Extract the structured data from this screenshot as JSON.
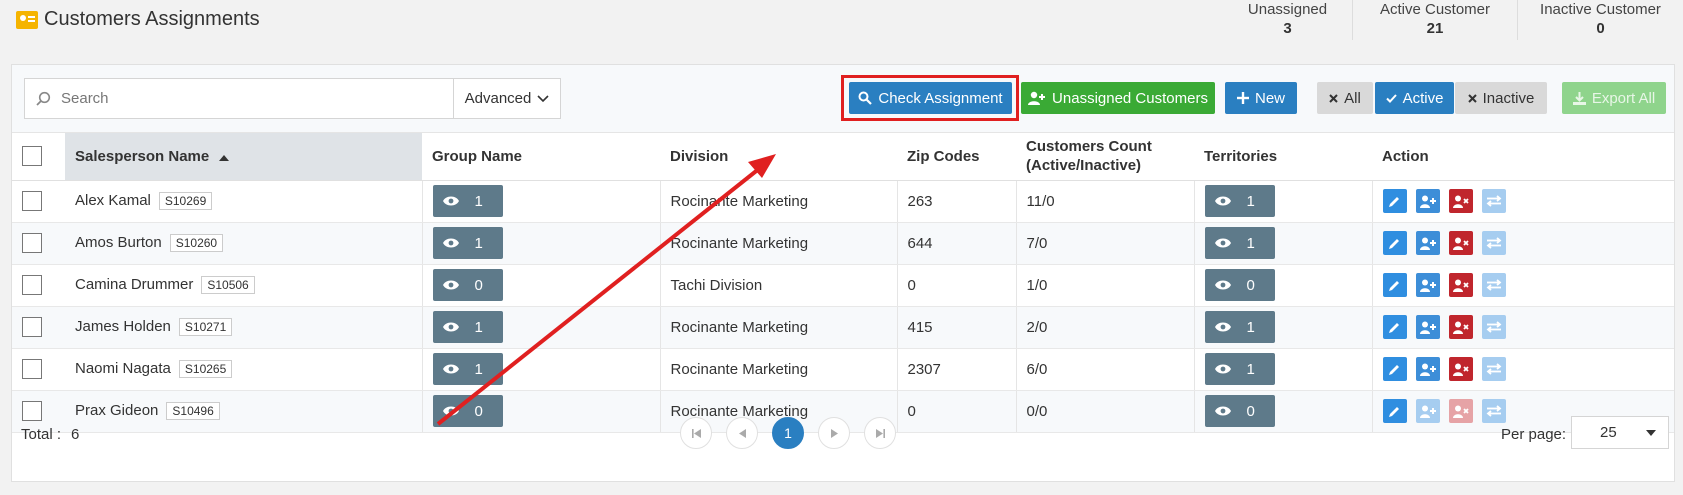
{
  "header": {
    "title": "Customers Assignments",
    "stats": [
      {
        "label": "Unassigned",
        "value": "3"
      },
      {
        "label": "Active Customer",
        "value": "21"
      },
      {
        "label": "Inactive Customer",
        "value": "0"
      }
    ]
  },
  "toolbar": {
    "search_placeholder": "Search",
    "advanced_label": "Advanced",
    "check_assignment_label": "Check Assignment",
    "unassigned_customers_label": "Unassigned Customers",
    "new_label": "New",
    "filter_all_label": "All",
    "filter_active_label": "Active",
    "filter_inactive_label": "Inactive",
    "export_label": "Export All"
  },
  "table": {
    "columns": {
      "salesperson": "Salesperson Name",
      "group": "Group Name",
      "division": "Division",
      "zip": "Zip Codes",
      "count_line1": "Customers Count",
      "count_line2": "(Active/Inactive)",
      "territories": "Territories",
      "action": "Action"
    },
    "rows": [
      {
        "name": "Alex Kamal",
        "code": "S10269",
        "group": "1",
        "division": "Rocinante Marketing",
        "zip": "263",
        "count": "11/0",
        "territories": "1"
      },
      {
        "name": "Amos Burton",
        "code": "S10260",
        "group": "1",
        "division": "Rocinante Marketing",
        "zip": "644",
        "count": "7/0",
        "territories": "1"
      },
      {
        "name": "Camina Drummer",
        "code": "S10506",
        "group": "0",
        "division": "Tachi Division",
        "zip": "0",
        "count": "1/0",
        "territories": "0"
      },
      {
        "name": "James Holden",
        "code": "S10271",
        "group": "1",
        "division": "Rocinante Marketing",
        "zip": "415",
        "count": "2/0",
        "territories": "1"
      },
      {
        "name": "Naomi Nagata",
        "code": "S10265",
        "group": "1",
        "division": "Rocinante Marketing",
        "zip": "2307",
        "count": "6/0",
        "territories": "1"
      },
      {
        "name": "Prax Gideon",
        "code": "S10496",
        "group": "0",
        "division": "Rocinante Marketing",
        "zip": "0",
        "count": "0/0",
        "territories": "0"
      }
    ]
  },
  "footer": {
    "total_label": "Total :",
    "total_value": "6",
    "current_page": "1",
    "per_page_label": "Per page:",
    "per_page_value": "25"
  },
  "colors": {
    "primary": "#2a7fc1",
    "success": "#3aaa35",
    "danger": "#c0262d",
    "eye_button": "#5e7a8a",
    "annotation": "#e02020"
  }
}
